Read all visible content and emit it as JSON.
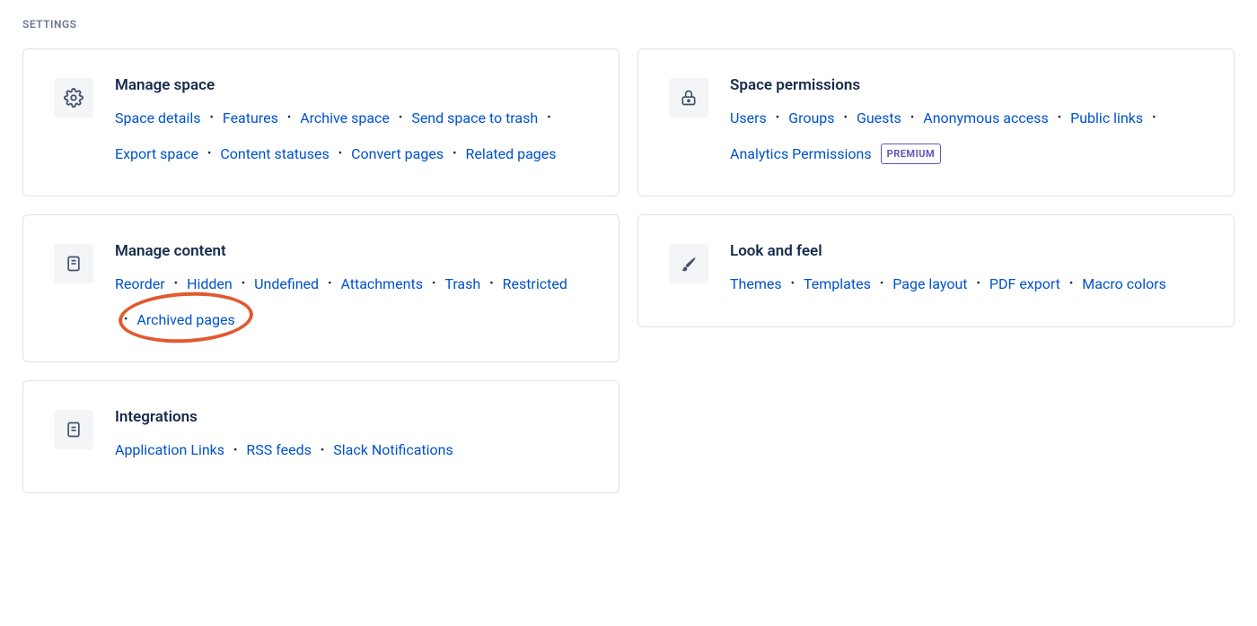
{
  "section_label": "SETTINGS",
  "cards": {
    "manage_space": {
      "title": "Manage space",
      "links": [
        "Space details",
        "Features",
        "Archive space",
        "Send space to trash",
        "Export space",
        "Content statuses",
        "Convert pages",
        "Related pages"
      ]
    },
    "space_permissions": {
      "title": "Space permissions",
      "links": [
        "Users",
        "Groups",
        "Guests",
        "Anonymous access",
        "Public links",
        "Analytics Permissions"
      ],
      "badge": "PREMIUM"
    },
    "manage_content": {
      "title": "Manage content",
      "links": [
        "Reorder",
        "Hidden",
        "Undefined",
        "Attachments",
        "Trash",
        "Restricted",
        "Archived pages"
      ]
    },
    "look_and_feel": {
      "title": "Look and feel",
      "links": [
        "Themes",
        "Templates",
        "Page layout",
        "PDF export",
        "Macro colors"
      ]
    },
    "integrations": {
      "title": "Integrations",
      "links": [
        "Application Links",
        "RSS feeds",
        "Slack Notifications"
      ]
    }
  }
}
